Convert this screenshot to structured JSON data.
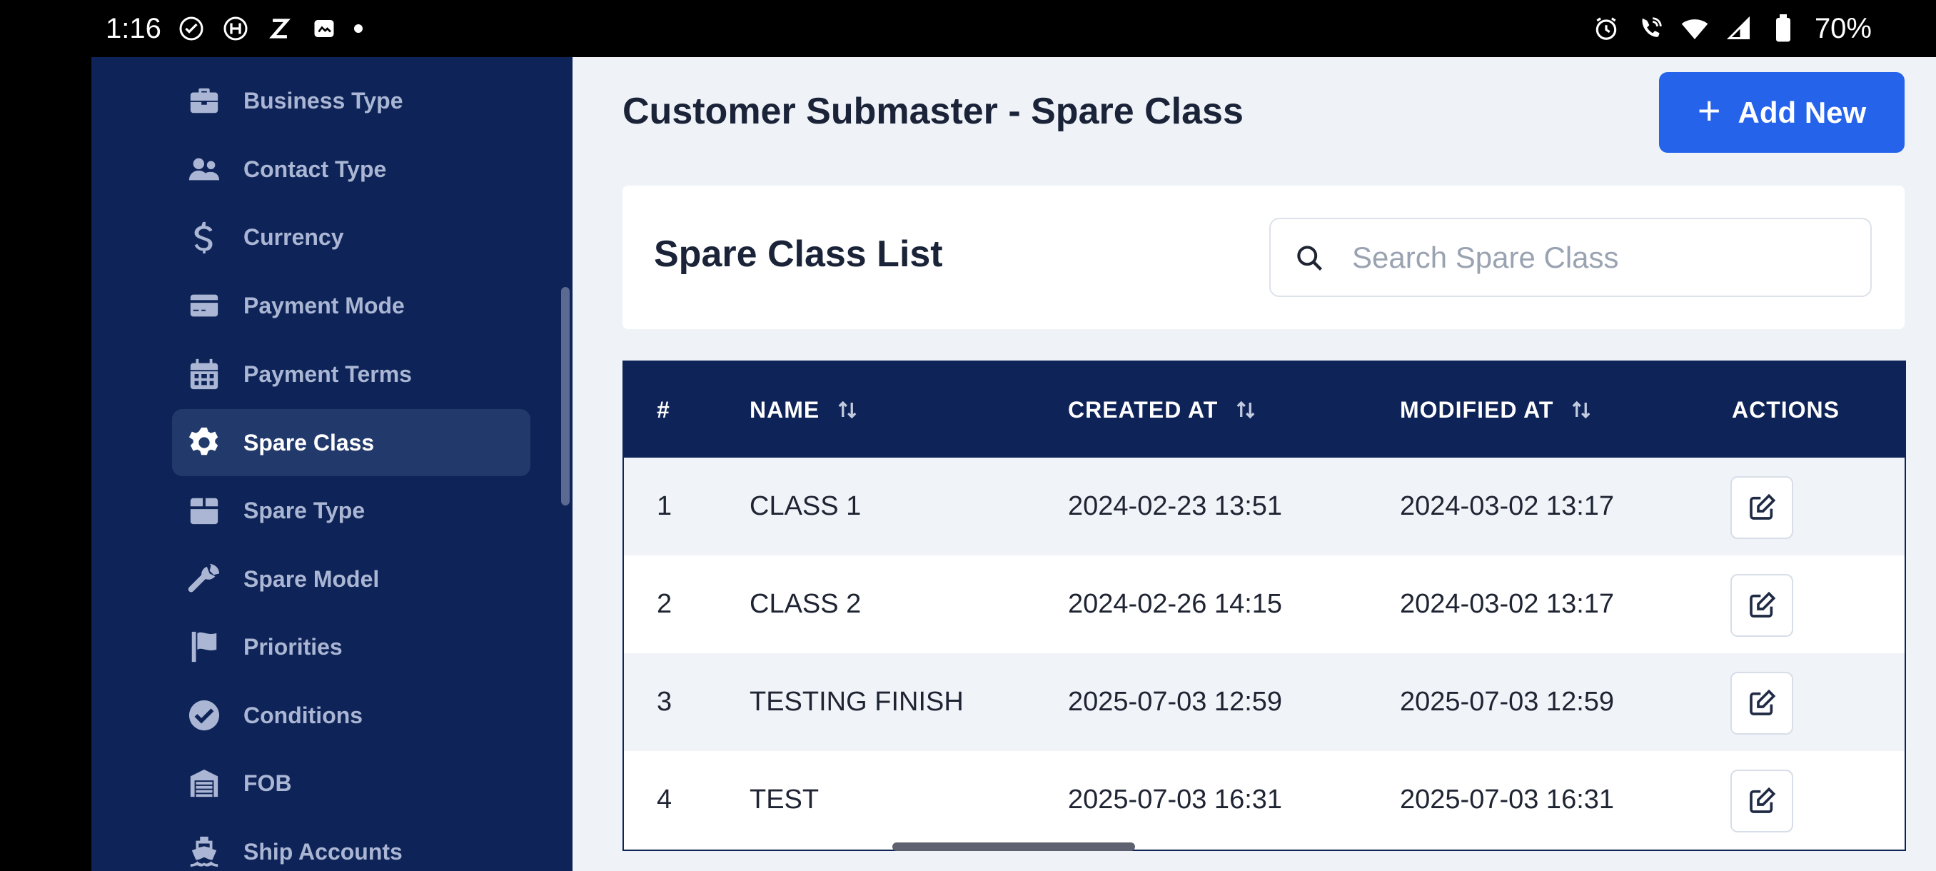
{
  "status_bar": {
    "time": "1:16",
    "battery": "70%"
  },
  "sidebar": {
    "items": [
      {
        "label": "Business Type",
        "icon": "briefcase-icon"
      },
      {
        "label": "Contact Type",
        "icon": "users-icon"
      },
      {
        "label": "Currency",
        "icon": "dollar-icon"
      },
      {
        "label": "Payment Mode",
        "icon": "credit-card-icon"
      },
      {
        "label": "Payment Terms",
        "icon": "calendar-icon"
      },
      {
        "label": "Spare Class",
        "icon": "gear-icon",
        "active": true
      },
      {
        "label": "Spare Type",
        "icon": "box-icon"
      },
      {
        "label": "Spare Model",
        "icon": "wrench-icon"
      },
      {
        "label": "Priorities",
        "icon": "flag-icon"
      },
      {
        "label": "Conditions",
        "icon": "check-circle-icon"
      },
      {
        "label": "FOB",
        "icon": "warehouse-icon"
      },
      {
        "label": "Ship Accounts",
        "icon": "ship-icon"
      }
    ]
  },
  "header": {
    "title": "Customer Submaster - Spare Class",
    "add_label": "Add New"
  },
  "list": {
    "title": "Spare Class List",
    "search_placeholder": "Search Spare Class"
  },
  "table": {
    "columns": [
      "#",
      "NAME",
      "CREATED AT",
      "MODIFIED AT",
      "ACTIONS"
    ],
    "rows": [
      {
        "num": "1",
        "name": "CLASS 1",
        "created": "2024-02-23 13:51",
        "modified": "2024-03-02 13:17"
      },
      {
        "num": "2",
        "name": "CLASS 2",
        "created": "2024-02-26 14:15",
        "modified": "2024-03-02 13:17"
      },
      {
        "num": "3",
        "name": "TESTING FINISH",
        "created": "2025-07-03 12:59",
        "modified": "2025-07-03 12:59"
      },
      {
        "num": "4",
        "name": "TEST",
        "created": "2025-07-03 16:31",
        "modified": "2025-07-03 16:31"
      }
    ]
  },
  "colors": {
    "sidebar_bg": "#0e2357",
    "accent": "#2563eb"
  }
}
